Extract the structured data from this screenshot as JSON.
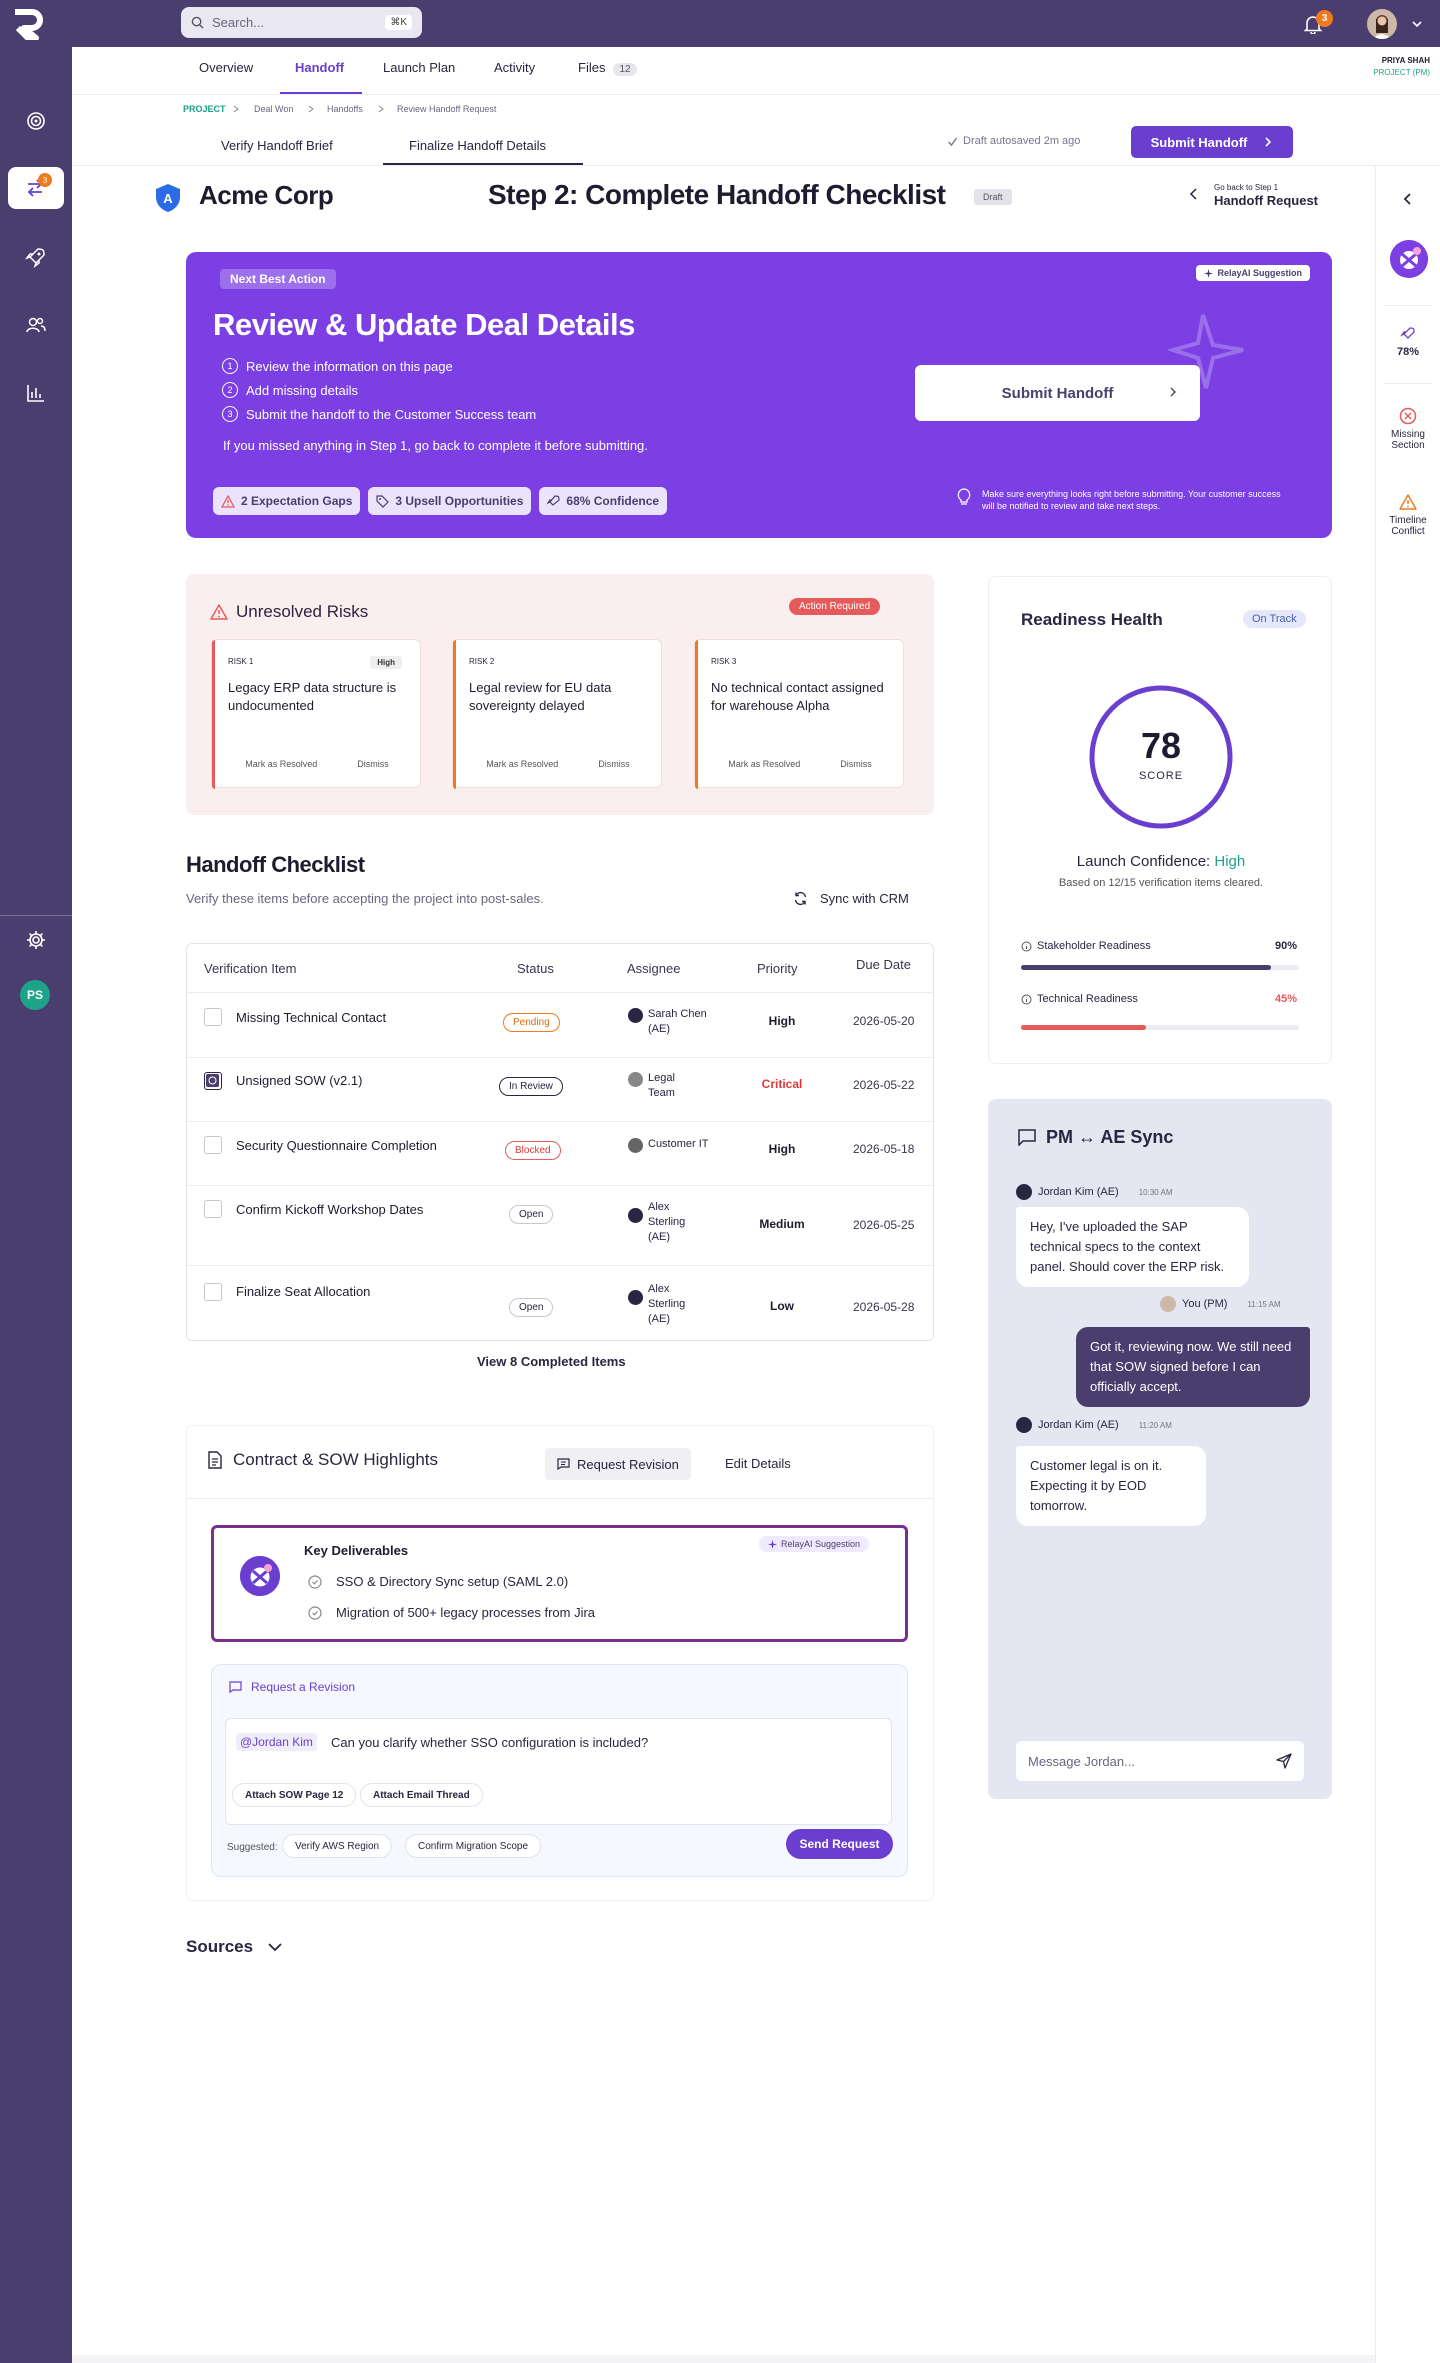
{
  "topbar": {
    "search_placeholder": "Search...",
    "search_shortcut": "⌘K",
    "notification_count": "3",
    "user_name": "PRIYA SHAH",
    "user_role": "PROJECT (PM)"
  },
  "sidebar": {
    "active_badge": "3",
    "user_initials": "PS"
  },
  "tabs": [
    "Overview",
    "Handoff",
    "Launch Plan",
    "Activity",
    "Files"
  ],
  "files_count": "12",
  "breadcrumb": [
    "PROJECT",
    "Deal Won",
    "Handoffs",
    "Review Handoff Request"
  ],
  "subtabs": [
    "Verify Handoff Brief",
    "Finalize Handoff Details"
  ],
  "autosave": "Draft autosaved 2m ago",
  "submit_top": "Submit Handoff",
  "title_row": {
    "company_initial": "A",
    "company": "Acme Corp",
    "step_title": "Step 2: Complete Handoff Checklist",
    "draft": "Draft",
    "goback_small": "Go back to Step 1",
    "goback_large": "Handoff Request"
  },
  "rail": {
    "percent": "78%",
    "missing": "Missing Section",
    "timeline": "Timeline Conflict"
  },
  "nba": {
    "pill": "Next Best Action",
    "relay": "RelayAI Suggestion",
    "title": "Review & Update Deal Details",
    "steps": [
      "Review the information on this page",
      "Add missing details",
      "Submit the handoff to the Customer Success team"
    ],
    "step_nums": [
      "1",
      "2",
      "3"
    ],
    "note": "If you missed anything in Step 1, go back to complete it before submitting.",
    "chips": [
      "2 Expectation Gaps",
      "3 Upsell Opportunities",
      "68% Confidence"
    ],
    "button": "Submit Handoff",
    "tip": "Make sure everything looks right before submitting. Your customer success will be notified to review and take next steps."
  },
  "risks": {
    "title": "Unresolved Risks",
    "badge": "Action Required",
    "items": [
      {
        "num": "RISK 1",
        "tag": "High",
        "title": "Legacy ERP data structure is undocumented",
        "resolve": "Mark as Resolved",
        "dismiss": "Dismiss",
        "color": "#e55a5a"
      },
      {
        "num": "RISK 2",
        "tag": "",
        "title": "Legal review for EU data sovereignty delayed",
        "resolve": "Mark as Resolved",
        "dismiss": "Dismiss",
        "color": "#f07a1e"
      },
      {
        "num": "RISK 3",
        "tag": "",
        "title": "No technical contact assigned for warehouse Alpha",
        "resolve": "Mark as Resolved",
        "dismiss": "Dismiss",
        "color": "#f07a1e"
      }
    ]
  },
  "checklist": {
    "title": "Handoff Checklist",
    "subtitle": "Verify these items before accepting the project into post-sales.",
    "sync": "Sync with CRM",
    "headers": [
      "Verification Item",
      "Status",
      "Assignee",
      "Priority",
      "Due Date"
    ],
    "rows": [
      {
        "item": "Missing Technical Contact",
        "status": "Pending",
        "assignee": [
          "Sarah Chen",
          "(AE)"
        ],
        "priority": "High",
        "due": "2026-05-20",
        "checked": false
      },
      {
        "item": "Unsigned SOW (v2.1)",
        "status": "In Review",
        "assignee": [
          "Legal",
          "Team"
        ],
        "priority": "Critical",
        "due": "2026-05-22",
        "checked": true
      },
      {
        "item": "Security Questionnaire Completion",
        "status": "Blocked",
        "assignee": [
          "Customer IT",
          ""
        ],
        "priority": "High",
        "due": "2026-05-18",
        "checked": false
      },
      {
        "item": "Confirm Kickoff Workshop Dates",
        "status": "Open",
        "assignee": [
          "Alex",
          "Sterling",
          "(AE)"
        ],
        "priority": "Medium",
        "due": "2026-05-25",
        "checked": false
      },
      {
        "item": "Finalize Seat Allocation",
        "status": "Open",
        "assignee": [
          "Alex",
          "Sterling",
          "(AE)"
        ],
        "priority": "Low",
        "due": "2026-05-28",
        "checked": false
      }
    ],
    "view_completed": "View 8 Completed Items"
  },
  "contract": {
    "title": "Contract & SOW Highlights",
    "request_revision": "Request Revision",
    "edit_details": "Edit Details",
    "deliverables_title": "Key Deliverables",
    "relay": "RelayAI Suggestion",
    "deliverables": [
      "SSO & Directory Sync setup (SAML 2.0)",
      "Migration of 500+ legacy processes from Jira"
    ],
    "revision_title": "Request a Revision",
    "mention": "@Jordan Kim",
    "revision_text": "Can you clarify whether SSO configuration is included?",
    "attachments": [
      "Attach SOW Page 12",
      "Attach Email Thread"
    ],
    "suggested_label": "Suggested:",
    "suggestions": [
      "Verify AWS Region",
      "Confirm Migration Scope"
    ],
    "send": "Send Request"
  },
  "sources": "Sources",
  "readiness": {
    "title": "Readiness Health",
    "status": "On Track",
    "score": "78",
    "score_value": 78,
    "score_label": "SCORE",
    "confidence_prefix": "Launch Confidence: ",
    "confidence": "High",
    "based_on": "Based on 12/15 verification items cleared.",
    "metrics": [
      {
        "label": "Stakeholder Readiness",
        "value": "90%",
        "fraction": 0.9,
        "color": "#4a3e6e"
      },
      {
        "label": "Technical Readiness",
        "value": "45%",
        "fraction": 0.45,
        "color": "#e55a5a"
      }
    ]
  },
  "sync": {
    "title": "PM ↔ AE Sync",
    "messages": [
      {
        "author": "Jordan Kim (AE)",
        "time": "10:30 AM",
        "text": "Hey, I've uploaded the SAP technical specs to the context panel. Should cover the ERP risk.",
        "dir": "in"
      },
      {
        "author": "You (PM)",
        "time": "11:15 AM",
        "text": "Got it, reviewing now. We still need that SOW signed before I can officially accept.",
        "dir": "out"
      },
      {
        "author": "Jordan Kim (AE)",
        "time": "11:20 AM",
        "text": "Customer legal is on it. Expecting it by EOD tomorrow.",
        "dir": "in"
      }
    ],
    "placeholder": "Message Jordan..."
  }
}
